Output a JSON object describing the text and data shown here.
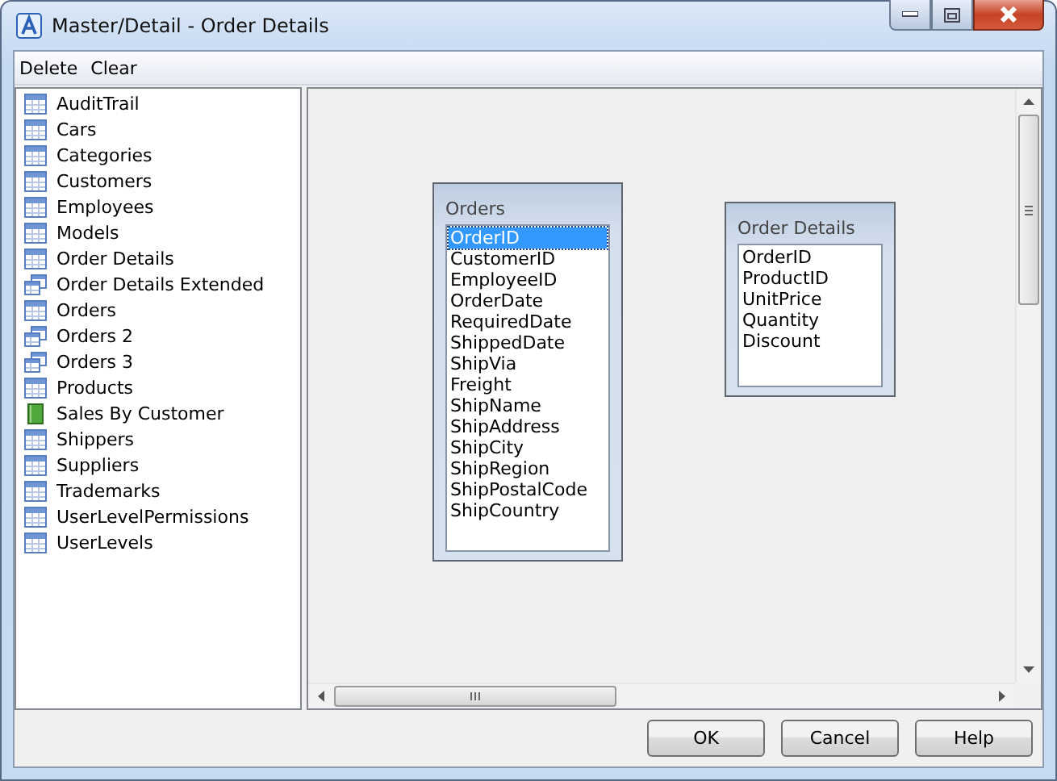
{
  "window": {
    "title": "Master/Detail - Order Details"
  },
  "menu": [
    "Delete",
    "Clear"
  ],
  "sidebar": {
    "items": [
      {
        "label": "AuditTrail",
        "kind": "table"
      },
      {
        "label": "Cars",
        "kind": "table"
      },
      {
        "label": "Categories",
        "kind": "table"
      },
      {
        "label": "Customers",
        "kind": "table"
      },
      {
        "label": "Employees",
        "kind": "table"
      },
      {
        "label": "Models",
        "kind": "table"
      },
      {
        "label": "Order Details",
        "kind": "table"
      },
      {
        "label": "Order Details Extended",
        "kind": "view"
      },
      {
        "label": "Orders",
        "kind": "table"
      },
      {
        "label": "Orders 2",
        "kind": "view"
      },
      {
        "label": "Orders 3",
        "kind": "view"
      },
      {
        "label": "Products",
        "kind": "table"
      },
      {
        "label": "Sales By Customer",
        "kind": "procedure"
      },
      {
        "label": "Shippers",
        "kind": "table"
      },
      {
        "label": "Suppliers",
        "kind": "table"
      },
      {
        "label": "Trademarks",
        "kind": "table"
      },
      {
        "label": "UserLevelPermissions",
        "kind": "table"
      },
      {
        "label": "UserLevels",
        "kind": "table"
      }
    ]
  },
  "canvas": {
    "tables": [
      {
        "title": "Orders",
        "fields": [
          {
            "name": "OrderID",
            "selected": true
          },
          {
            "name": "CustomerID",
            "selected": false
          },
          {
            "name": "EmployeeID",
            "selected": false
          },
          {
            "name": "OrderDate",
            "selected": false
          },
          {
            "name": "RequiredDate",
            "selected": false
          },
          {
            "name": "ShippedDate",
            "selected": false
          },
          {
            "name": "ShipVia",
            "selected": false
          },
          {
            "name": "Freight",
            "selected": false
          },
          {
            "name": "ShipName",
            "selected": false
          },
          {
            "name": "ShipAddress",
            "selected": false
          },
          {
            "name": "ShipCity",
            "selected": false
          },
          {
            "name": "ShipRegion",
            "selected": false
          },
          {
            "name": "ShipPostalCode",
            "selected": false
          },
          {
            "name": "ShipCountry",
            "selected": false
          }
        ]
      },
      {
        "title": "Order Details",
        "fields": [
          {
            "name": "OrderID",
            "selected": false
          },
          {
            "name": "ProductID",
            "selected": false
          },
          {
            "name": "UnitPrice",
            "selected": false
          },
          {
            "name": "Quantity",
            "selected": false
          },
          {
            "name": "Discount",
            "selected": false
          }
        ]
      }
    ]
  },
  "buttons": [
    "OK",
    "Cancel",
    "Help"
  ]
}
